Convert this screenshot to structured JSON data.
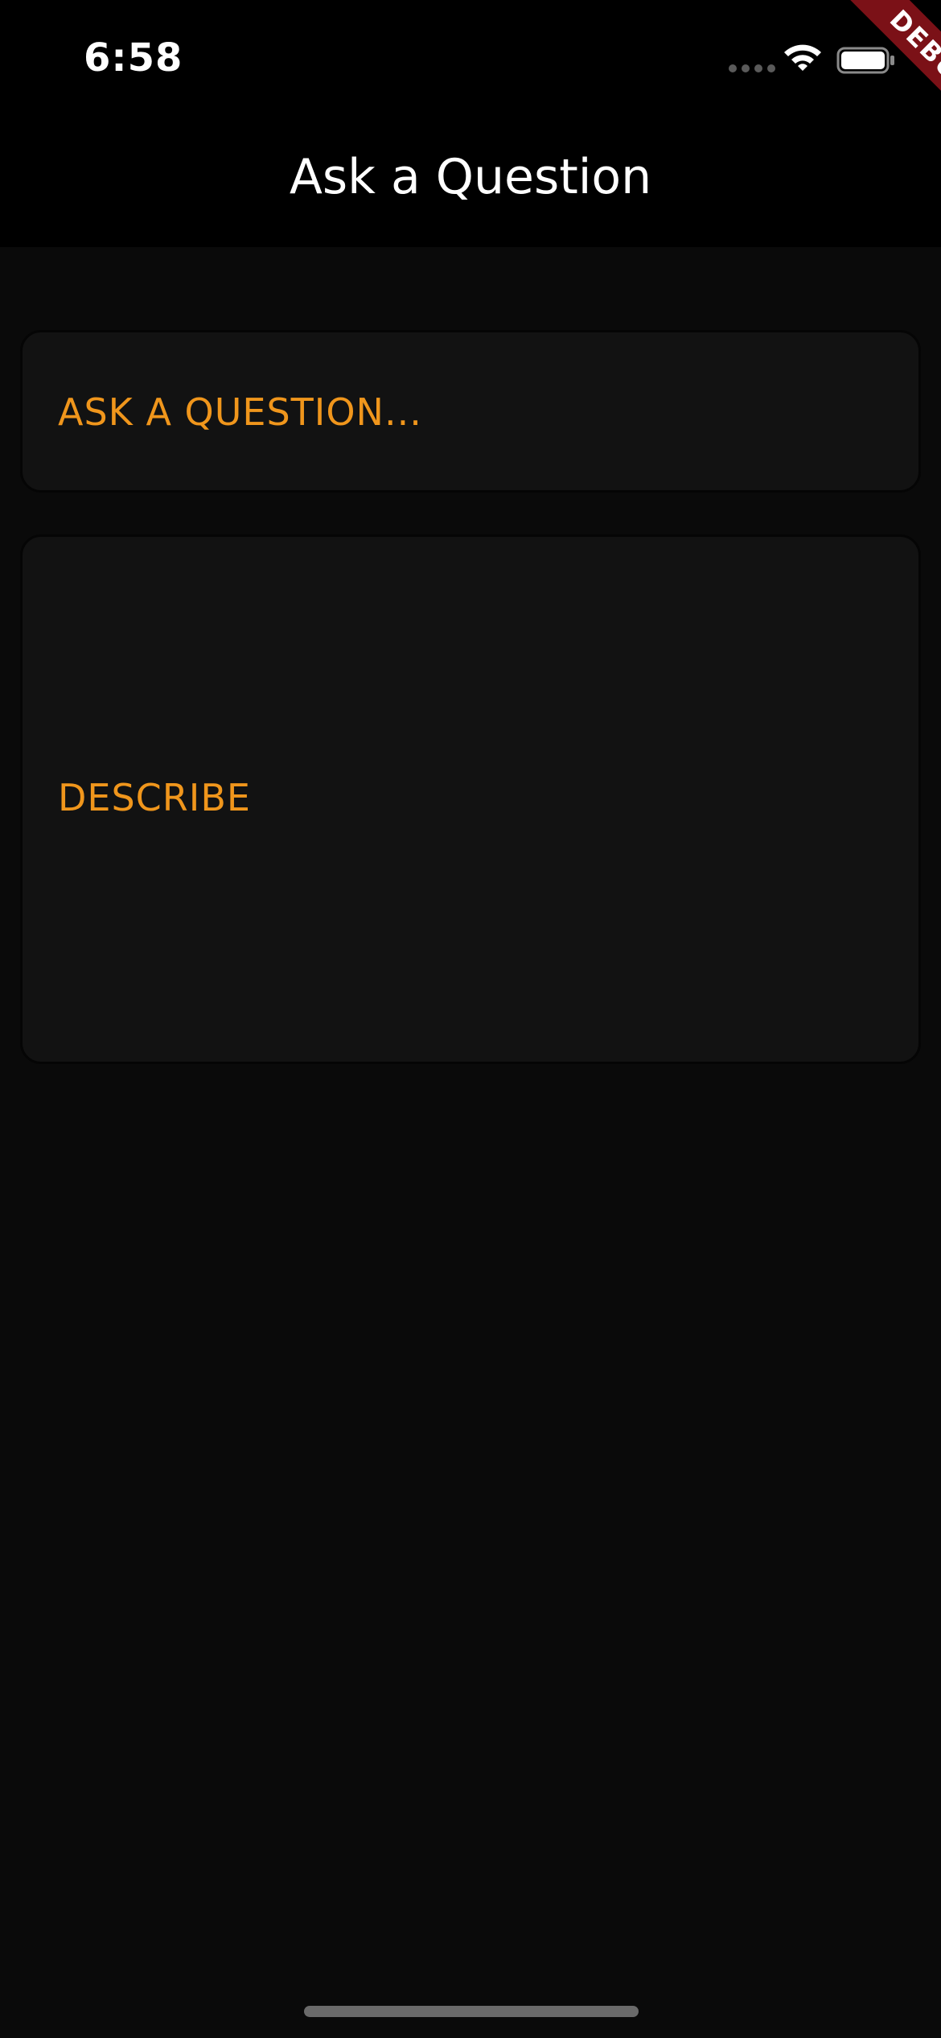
{
  "status_bar": {
    "time": "6:58"
  },
  "app_bar": {
    "title": "Ask a Question"
  },
  "debug_banner": {
    "label": "DEBUG",
    "color": "#7b1117"
  },
  "form": {
    "question_placeholder": "ASK A QUESTION...",
    "describe_placeholder": "DESCRIBE"
  },
  "colors": {
    "accent": "#f0961c",
    "background": "#0a0a0a",
    "field_background": "#121212"
  },
  "icons": {
    "signal": "cellular-signal-icon",
    "wifi": "wifi-icon",
    "battery": "battery-icon"
  }
}
